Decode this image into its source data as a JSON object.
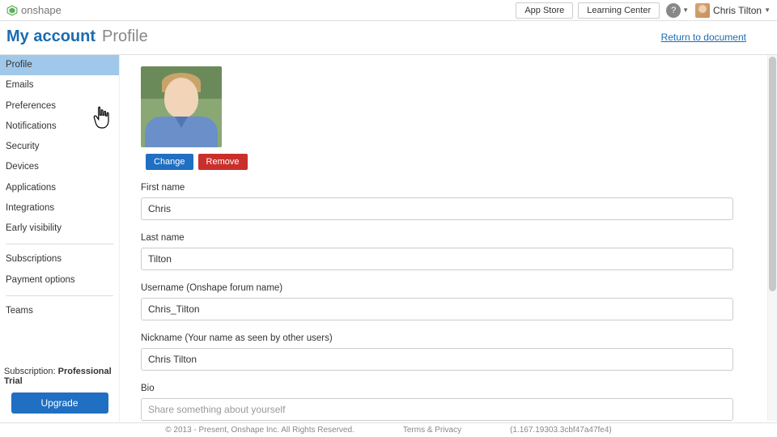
{
  "topbar": {
    "brand": "onshape",
    "app_store": "App Store",
    "learning_center": "Learning Center",
    "user_name": "Chris Tilton"
  },
  "header": {
    "main": "My account",
    "sub": "Profile",
    "return": "Return to document"
  },
  "sidebar": {
    "items": [
      "Profile",
      "Emails",
      "Preferences",
      "Notifications",
      "Security",
      "Devices",
      "Applications",
      "Integrations",
      "Early visibility"
    ],
    "items2": [
      "Subscriptions",
      "Payment options"
    ],
    "items3": [
      "Teams"
    ],
    "subscription_label": "Subscription: ",
    "subscription_value": "Professional Trial",
    "upgrade": "Upgrade"
  },
  "profile": {
    "change": "Change",
    "remove": "Remove",
    "first_name_label": "First name",
    "first_name": "Chris",
    "last_name_label": "Last name",
    "last_name": "Tilton",
    "username_label": "Username (Onshape forum name)",
    "username": "Chris_Tilton",
    "nickname_label": "Nickname (Your name as seen by other users)",
    "nickname": "Chris Tilton",
    "bio_label": "Bio",
    "bio_placeholder": "Share something about yourself"
  },
  "footer": {
    "copyright": "© 2013 - Present, Onshape Inc. All Rights Reserved.",
    "terms": "Terms & Privacy",
    "build": "(1.167.19303.3cbf47a47fe4)"
  }
}
